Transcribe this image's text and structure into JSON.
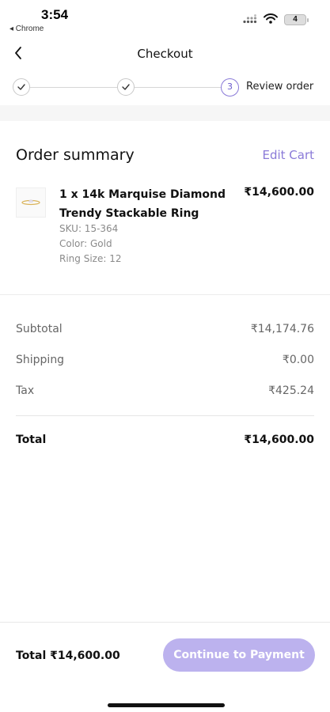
{
  "status_bar": {
    "time": "3:54",
    "back_app": "◂ Chrome",
    "battery": "4"
  },
  "header": {
    "title": "Checkout"
  },
  "stepper": {
    "current_step_number": "3",
    "current_step_label": "Review order"
  },
  "order_summary": {
    "title": "Order summary",
    "edit_cart_label": "Edit Cart",
    "item": {
      "name": "1 x 14k Marquise Diamond Trendy Stackable Ring",
      "price": "₹14,600.00",
      "sku": "SKU: 15-364",
      "color": "Color: Gold",
      "ring_size": "Ring Size: 12"
    }
  },
  "totals": {
    "subtotal_label": "Subtotal",
    "subtotal_value": "₹14,174.76",
    "shipping_label": "Shipping",
    "shipping_value": "₹0.00",
    "tax_label": "Tax",
    "tax_value": "₹425.24",
    "total_label": "Total",
    "total_value": "₹14,600.00"
  },
  "footer": {
    "total_text": "Total ₹14,600.00",
    "cta_label": "Continue to Payment"
  },
  "colors": {
    "accent": "#8a7ad8",
    "cta_background": "#bcb2ee"
  }
}
